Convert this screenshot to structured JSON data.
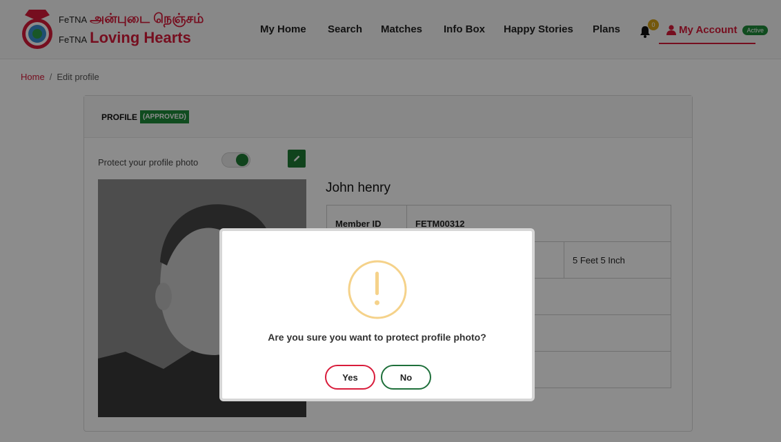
{
  "brand": {
    "prefix1": "FeTNA",
    "tamil": "அன்புடை நெஞ்சம்",
    "prefix2": "FeTNA",
    "english": "Loving Hearts"
  },
  "nav": [
    {
      "label": "My Home"
    },
    {
      "label": "Search"
    },
    {
      "label": "Matches"
    },
    {
      "label": "Info Box"
    },
    {
      "label": "Happy Stories"
    },
    {
      "label": "Plans"
    }
  ],
  "notifications": {
    "count": "0",
    "icon": "bell-icon"
  },
  "account": {
    "label": "My Account",
    "status": "Active",
    "icon": "user-icon"
  },
  "breadcrumb": {
    "home": "Home",
    "separator": "/",
    "current": "Edit profile"
  },
  "profile": {
    "title": "PROFILE",
    "status": "(APPROVED)",
    "protect_label": "Protect your profile photo",
    "protect_enabled": true,
    "name": "John henry",
    "member_id_label": "Member ID",
    "member_id": "FETM00312",
    "height": "5 Feet 5 Inch"
  },
  "dialog": {
    "icon": "warning-icon",
    "message": "Are you sure you want to protect profile photo?",
    "yes": "Yes",
    "no": "No"
  },
  "colors": {
    "brand_red": "#d81b3a",
    "green": "#1e7a34",
    "warning": "#f5d28a"
  }
}
